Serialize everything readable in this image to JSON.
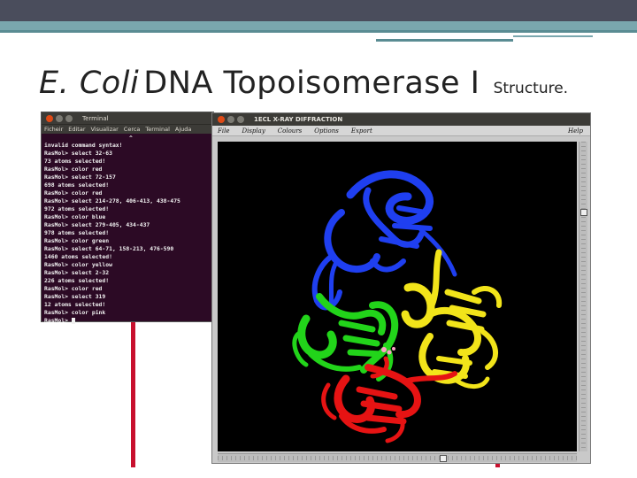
{
  "slide": {
    "title_italic": "E. Coli",
    "title_main": "DNA Topoisomerase I",
    "title_small": "Structure."
  },
  "terminal": {
    "window_title": "Terminal",
    "menu": [
      "Ficheir",
      "Editar",
      "Visualizar",
      "Cerca",
      "Terminal",
      "Ajuda"
    ],
    "lines": [
      "invalid command syntax!",
      "RasMol> select 32-63",
      "73 atoms selected!",
      "RasMol> color red",
      "RasMol> select 72-157",
      "698 atoms selected!",
      "RasMol> color red",
      "RasMol> select 214-278, 406-413, 438-475",
      "972 atoms selected!",
      "RasMol> color blue",
      "RasMol> select 279-405, 434-437",
      "978 atoms selected!",
      "RasMol> color green",
      "RasMol> select 64-71, 158-213, 476-590",
      "1460 atoms selected!",
      "RasMol> color yellow",
      "RasMol> select 2-32",
      "226 atoms selected!",
      "RasMol> color red",
      "RasMol> select 319",
      "12 atoms selected!",
      "RasMol> color pink",
      "RasMol> "
    ],
    "caret": "^"
  },
  "rasmol": {
    "window_title": "1ECL X-RAY DIFFRACTION",
    "menu": [
      "File",
      "Display",
      "Colours",
      "Options",
      "Export"
    ],
    "help": "Help"
  },
  "colors": {
    "blue_domain": "#1f3ff0",
    "green_domain": "#22d41a",
    "yellow_domain": "#f2e41a",
    "red_domain": "#e61313",
    "pink_residue": "#ff9ec7"
  }
}
